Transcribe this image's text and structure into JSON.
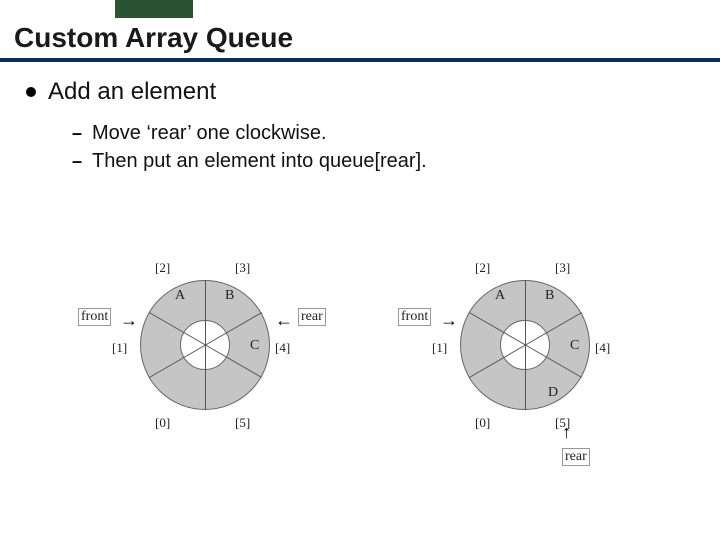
{
  "slide": {
    "title": "Custom Array Queue",
    "main_bullet": "Add an element",
    "sub_bullets": [
      "Move ‘rear’ one clockwise.",
      "Then put an element into queue[rear]."
    ]
  },
  "diagrams": {
    "left": {
      "indices": [
        "[0]",
        "[1]",
        "[2]",
        "[3]",
        "[4]",
        "[5]"
      ],
      "segments": [
        "A",
        "B",
        "C"
      ],
      "front_label": "front",
      "rear_label": "rear"
    },
    "right": {
      "indices": [
        "[0]",
        "[1]",
        "[2]",
        "[3]",
        "[4]",
        "[5]"
      ],
      "segments": [
        "A",
        "B",
        "C",
        "D"
      ],
      "front_label": "front",
      "rear_label": "rear"
    }
  }
}
